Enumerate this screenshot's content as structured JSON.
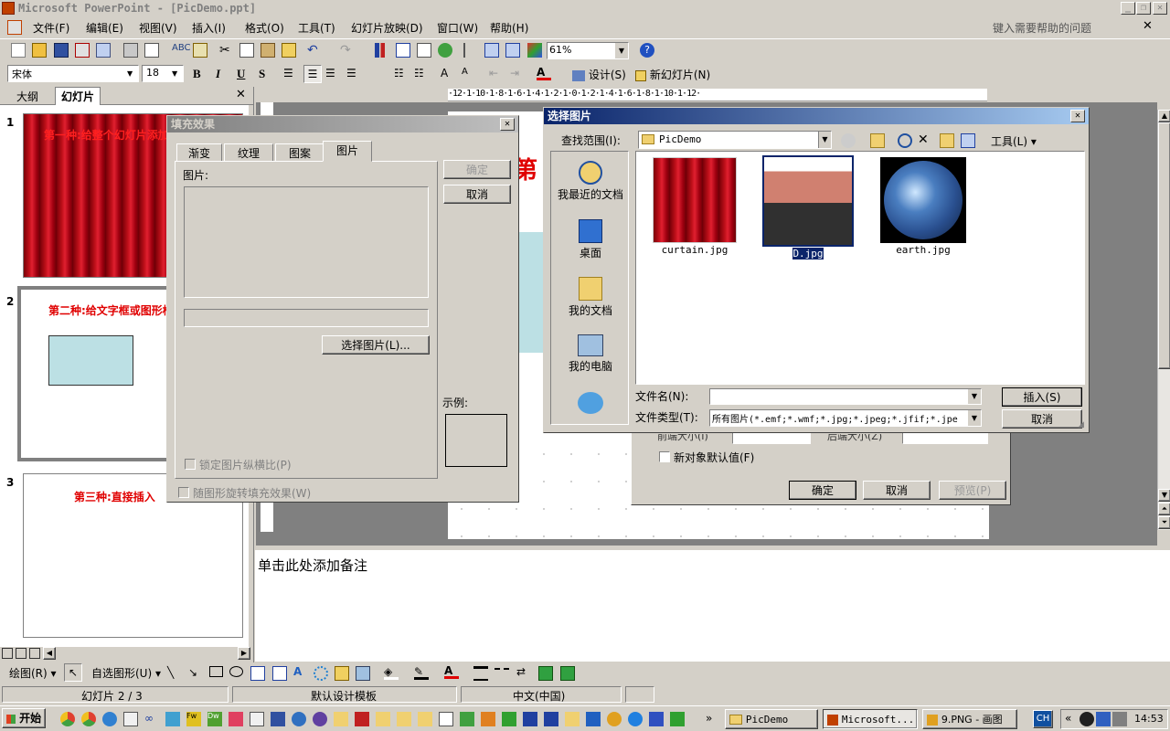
{
  "app": {
    "title": "Microsoft PowerPoint - [PicDemo.ppt]",
    "menu": [
      "文件(F)",
      "编辑(E)",
      "视图(V)",
      "插入(I)",
      "格式(O)",
      "工具(T)",
      "幻灯片放映(D)",
      "窗口(W)",
      "帮助(H)"
    ],
    "help_placeholder": "键入需要帮助的问题",
    "zoom": "61%",
    "font_name": "宋体",
    "font_size": "18",
    "bold": "B",
    "italic": "I",
    "underline": "U",
    "shadow": "S",
    "design_label": "设计(S)",
    "new_slide_label": "新幻灯片(N)"
  },
  "panel": {
    "tabs": [
      "大纲",
      "幻灯片"
    ],
    "slides": [
      {
        "num": "1",
        "title": "第一种:给整个幻灯片添加"
      },
      {
        "num": "2",
        "title": "第二种:给文字框或图形框"
      },
      {
        "num": "3",
        "title": "第三种:直接插入"
      }
    ]
  },
  "slide_title_partial": "第",
  "notes_placeholder": "单击此处添加备注",
  "fill_dialog": {
    "title": "填充效果",
    "tabs": [
      "渐变",
      "纹理",
      "图案",
      "图片"
    ],
    "picture_label": "图片:",
    "select_picture_btn": "选择图片(L)...",
    "lock_aspect": "锁定图片纵横比(P)",
    "rotate_with_shape": "随图形旋转填充效果(W)",
    "ok": "确定",
    "cancel": "取消",
    "example_label": "示例:"
  },
  "back_dialog": {
    "front_size_label": "前端大小(I)",
    "back_size_label": "后端大小(Z)",
    "default_checkbox": "新对象默认值(F)",
    "ok": "确定",
    "cancel": "取消",
    "preview": "预览(P)"
  },
  "file_dialog": {
    "title": "选择图片",
    "lookin_label": "查找范围(I):",
    "lookin_value": "PicDemo",
    "tools_label": "工具(L)",
    "places": [
      "我最近的文档",
      "桌面",
      "我的文档",
      "我的电脑",
      ""
    ],
    "files": [
      {
        "name": "curtain.jpg",
        "selected": false
      },
      {
        "name": "D.jpg",
        "selected": true
      },
      {
        "name": "earth.jpg",
        "selected": false
      }
    ],
    "filename_label": "文件名(N):",
    "filename_value": "",
    "filetype_label": "文件类型(T):",
    "filetype_value": "所有图片(*.emf;*.wmf;*.jpg;*.jpeg;*.jfif;*.jpe",
    "insert_btn": "插入(S)",
    "cancel_btn": "取消"
  },
  "drawing": {
    "draw_label": "绘图(R)",
    "autoshapes_label": "自选图形(U)"
  },
  "status": {
    "slide": "幻灯片 2 / 3",
    "template": "默认设计模板",
    "language": "中文(中国)"
  },
  "taskbar": {
    "start": "开始",
    "tasks": [
      "PicDemo",
      "Microsoft...",
      "9.PNG - 画图"
    ],
    "lang": "CH",
    "time": "14:53"
  },
  "colors": {
    "title_active": "#0a246a",
    "title_active_end": "#a6caf0",
    "face": "#d4d0c8",
    "slide_title_red": "#e00000",
    "taskbar_blue": "#245edb",
    "start_green": "#3c9a3c"
  }
}
